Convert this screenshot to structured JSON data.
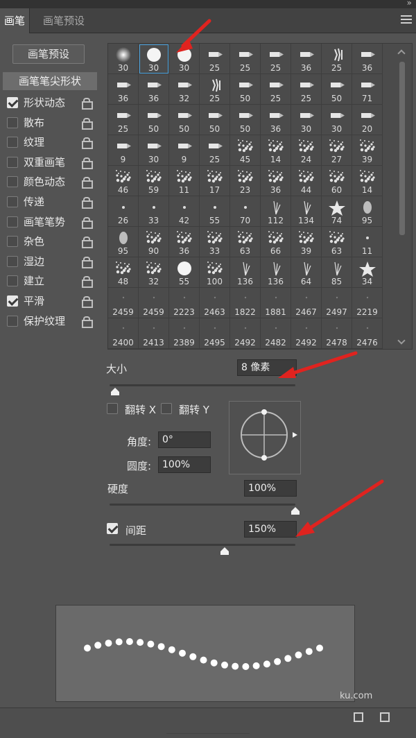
{
  "tabs": [
    {
      "label": "画笔",
      "active": true
    },
    {
      "label": "画笔预设",
      "active": false
    }
  ],
  "sidebar": {
    "preset_button": "画笔预设",
    "tip_shape": "画笔笔尖形状",
    "options": [
      {
        "label": "形状动态",
        "checked": true
      },
      {
        "label": "散布",
        "checked": false
      },
      {
        "label": "纹理",
        "checked": false
      },
      {
        "label": "双重画笔",
        "checked": false
      },
      {
        "label": "颜色动态",
        "checked": false
      },
      {
        "label": "传递",
        "checked": false
      },
      {
        "label": "画笔笔势",
        "checked": false
      },
      {
        "label": "杂色",
        "checked": false
      },
      {
        "label": "湿边",
        "checked": false
      },
      {
        "label": "建立",
        "checked": false
      },
      {
        "label": "平滑",
        "checked": true
      },
      {
        "label": "保护纹理",
        "checked": false
      }
    ]
  },
  "brushes": {
    "selected_index": 1,
    "items": [
      {
        "size": "30",
        "icon": "soft-round"
      },
      {
        "size": "30",
        "icon": "hard-round"
      },
      {
        "size": "30",
        "icon": "hard-round"
      },
      {
        "size": "25",
        "icon": "chalk"
      },
      {
        "size": "25",
        "icon": "chalk"
      },
      {
        "size": "25",
        "icon": "chalk"
      },
      {
        "size": "36",
        "icon": "chalk"
      },
      {
        "size": "25",
        "icon": "star-splat"
      },
      {
        "size": "36",
        "icon": "chalk"
      },
      {
        "size": "36",
        "icon": "chalk"
      },
      {
        "size": "36",
        "icon": "chalk"
      },
      {
        "size": "32",
        "icon": "chalk"
      },
      {
        "size": "25",
        "icon": "fan"
      },
      {
        "size": "50",
        "icon": "chalk"
      },
      {
        "size": "25",
        "icon": "chalk"
      },
      {
        "size": "25",
        "icon": "chalk"
      },
      {
        "size": "50",
        "icon": "chalk"
      },
      {
        "size": "71",
        "icon": "chalk"
      },
      {
        "size": "25",
        "icon": "chalk"
      },
      {
        "size": "50",
        "icon": "chalk"
      },
      {
        "size": "50",
        "icon": "chalk"
      },
      {
        "size": "50",
        "icon": "chalk"
      },
      {
        "size": "50",
        "icon": "chalk"
      },
      {
        "size": "36",
        "icon": "chalk"
      },
      {
        "size": "30",
        "icon": "chalk"
      },
      {
        "size": "30",
        "icon": "chalk"
      },
      {
        "size": "20",
        "icon": "chalk"
      },
      {
        "size": "9",
        "icon": "chalk"
      },
      {
        "size": "30",
        "icon": "chalk"
      },
      {
        "size": "9",
        "icon": "chalk"
      },
      {
        "size": "25",
        "icon": "chalk"
      },
      {
        "size": "45",
        "icon": "splatter"
      },
      {
        "size": "14",
        "icon": "splatter"
      },
      {
        "size": "24",
        "icon": "splatter"
      },
      {
        "size": "27",
        "icon": "splatter"
      },
      {
        "size": "39",
        "icon": "splatter"
      },
      {
        "size": "46",
        "icon": "splatter"
      },
      {
        "size": "59",
        "icon": "splatter"
      },
      {
        "size": "11",
        "icon": "splatter"
      },
      {
        "size": "17",
        "icon": "splatter"
      },
      {
        "size": "23",
        "icon": "splatter"
      },
      {
        "size": "36",
        "icon": "splatter"
      },
      {
        "size": "44",
        "icon": "splatter"
      },
      {
        "size": "60",
        "icon": "splatter"
      },
      {
        "size": "14",
        "icon": "splatter"
      },
      {
        "size": "26",
        "icon": "dot"
      },
      {
        "size": "33",
        "icon": "dot"
      },
      {
        "size": "42",
        "icon": "dot"
      },
      {
        "size": "55",
        "icon": "dot"
      },
      {
        "size": "70",
        "icon": "dot"
      },
      {
        "size": "112",
        "icon": "grass"
      },
      {
        "size": "134",
        "icon": "grass"
      },
      {
        "size": "74",
        "icon": "star"
      },
      {
        "size": "95",
        "icon": "leaf"
      },
      {
        "size": "95",
        "icon": "leaf"
      },
      {
        "size": "90",
        "icon": "splatter"
      },
      {
        "size": "36",
        "icon": "splatter"
      },
      {
        "size": "33",
        "icon": "splatter"
      },
      {
        "size": "63",
        "icon": "splatter"
      },
      {
        "size": "66",
        "icon": "splatter"
      },
      {
        "size": "39",
        "icon": "splatter"
      },
      {
        "size": "63",
        "icon": "splatter"
      },
      {
        "size": "11",
        "icon": "dot"
      },
      {
        "size": "48",
        "icon": "splatter"
      },
      {
        "size": "32",
        "icon": "splatter"
      },
      {
        "size": "55",
        "icon": "hard-round"
      },
      {
        "size": "100",
        "icon": "texture"
      },
      {
        "size": "136",
        "icon": "grass"
      },
      {
        "size": "136",
        "icon": "grass"
      },
      {
        "size": "64",
        "icon": "grass"
      },
      {
        "size": "85",
        "icon": "grass"
      },
      {
        "size": "34",
        "icon": "star"
      },
      {
        "size": "2459",
        "icon": "faint"
      },
      {
        "size": "2459",
        "icon": "faint"
      },
      {
        "size": "2223",
        "icon": "faint"
      },
      {
        "size": "2463",
        "icon": "faint"
      },
      {
        "size": "1822",
        "icon": "faint"
      },
      {
        "size": "1881",
        "icon": "faint"
      },
      {
        "size": "2467",
        "icon": "faint"
      },
      {
        "size": "2497",
        "icon": "faint"
      },
      {
        "size": "2219",
        "icon": "faint"
      },
      {
        "size": "2400",
        "icon": "faint"
      },
      {
        "size": "2413",
        "icon": "faint"
      },
      {
        "size": "2389",
        "icon": "faint"
      },
      {
        "size": "2495",
        "icon": "faint"
      },
      {
        "size": "2492",
        "icon": "faint"
      },
      {
        "size": "2482",
        "icon": "faint"
      },
      {
        "size": "2492",
        "icon": "faint"
      },
      {
        "size": "2478",
        "icon": "faint"
      },
      {
        "size": "2476",
        "icon": "faint"
      }
    ]
  },
  "size": {
    "label": "大小",
    "value": "8 像素",
    "slider_fraction": 0.03
  },
  "flip": {
    "x_label": "翻转 X",
    "y_label": "翻转 Y"
  },
  "angle": {
    "label": "角度:",
    "value": "0°"
  },
  "roundness": {
    "label": "圆度:",
    "value": "100%"
  },
  "hardness": {
    "label": "硬度",
    "value": "100%",
    "slider_fraction": 1.0
  },
  "spacing": {
    "label": "间距",
    "value": "150%",
    "checked": true,
    "slider_fraction": 0.62
  },
  "watermark": "ku.com"
}
